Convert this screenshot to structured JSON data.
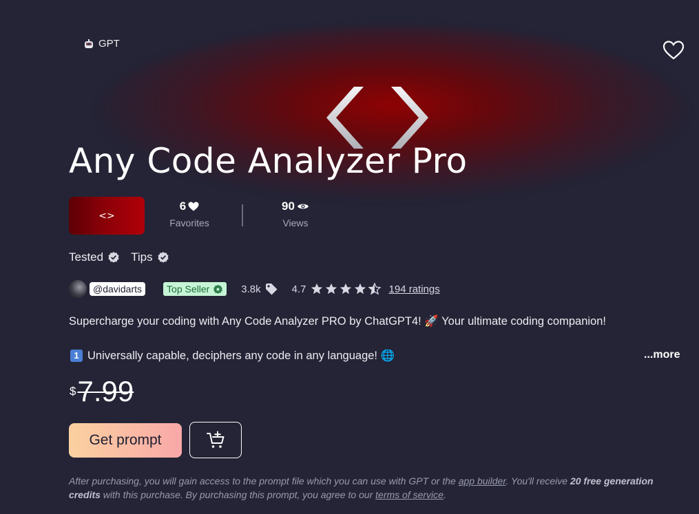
{
  "category": {
    "label": "GPT",
    "icon": "robot-icon"
  },
  "title": "Any Code Analyzer Pro",
  "thumbnail_glyph": "<>",
  "stats": {
    "favorites": {
      "value": "6",
      "label": "Favorites",
      "icon": "heart-icon"
    },
    "views": {
      "value": "90",
      "label": "Views",
      "icon": "eye-icon"
    }
  },
  "badges": [
    {
      "label": "Tested",
      "icon": "verified-check-icon"
    },
    {
      "label": "Tips",
      "icon": "verified-check-icon"
    }
  ],
  "seller": {
    "handle": "@davidarts",
    "top_seller_label": "Top Seller",
    "sales": "3.8k",
    "rating": "4.7",
    "rating_stars": 4.5,
    "ratings_link": "194 ratings"
  },
  "description": {
    "line1": "Supercharge your coding with Any Code Analyzer PRO by ChatGPT4! 🚀 Your ultimate coding companion!",
    "line2_number": "1",
    "line2": "Universally capable, deciphers any code in any language! 🌐",
    "more_label": "...more"
  },
  "price": {
    "currency": "$",
    "amount": "7.99"
  },
  "buttons": {
    "get_prompt": "Get prompt",
    "cart_icon": "add-to-cart-icon"
  },
  "disclaimer": {
    "part1": "After purchasing, you will gain access to the prompt file which you can use with GPT or the ",
    "app_builder_link": "app builder",
    "part2": ". You'll receive ",
    "credits_bold": "20 free generation credits",
    "part3": " with this purchase. By purchasing this prompt, you agree to our ",
    "terms_link": "terms of service",
    "part4": "."
  },
  "colors": {
    "background": "#242436",
    "accent_red": "#8a0008",
    "top_seller_bg": "#c6f5d6",
    "get_prompt_gradient_start": "#fbd1a0",
    "get_prompt_gradient_end": "#f9a8a8"
  }
}
